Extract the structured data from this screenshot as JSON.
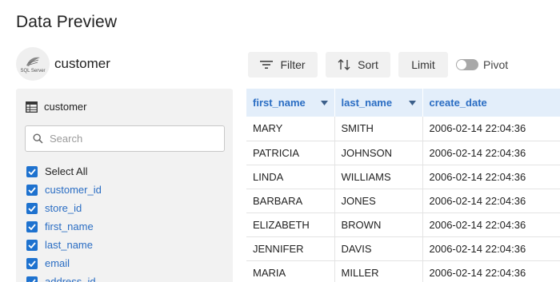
{
  "page": {
    "title": "Data Preview"
  },
  "source": {
    "name": "customer",
    "logo_text_1": "SQL Server"
  },
  "toolbar": {
    "filter_label": "Filter",
    "sort_label": "Sort",
    "limit_label": "Limit",
    "pivot_label": "Pivot",
    "pivot_on": false
  },
  "sidebar": {
    "table_name": "customer",
    "search_placeholder": "Search",
    "search_value": "",
    "select_all_label": "Select All",
    "columns": [
      "customer_id",
      "store_id",
      "first_name",
      "last_name",
      "email",
      "address_id"
    ]
  },
  "grid": {
    "columns": [
      "first_name",
      "last_name",
      "create_date"
    ],
    "rows": [
      [
        "MARY",
        "SMITH",
        "2006-02-14 22:04:36"
      ],
      [
        "PATRICIA",
        "JOHNSON",
        "2006-02-14 22:04:36"
      ],
      [
        "LINDA",
        "WILLIAMS",
        "2006-02-14 22:04:36"
      ],
      [
        "BARBARA",
        "JONES",
        "2006-02-14 22:04:36"
      ],
      [
        "ELIZABETH",
        "BROWN",
        "2006-02-14 22:04:36"
      ],
      [
        "JENNIFER",
        "DAVIS",
        "2006-02-14 22:04:36"
      ],
      [
        "MARIA",
        "MILLER",
        "2006-02-14 22:04:36"
      ]
    ]
  },
  "colors": {
    "accent": "#1e72cf",
    "header_bg": "#e3eefa",
    "header_text": "#2a6dc3",
    "panel_bg": "#f2f2f2",
    "button_bg": "#f1f1f1"
  },
  "icons": {
    "filter": "filter-lines-icon",
    "sort": "sort-arrows-icon",
    "table": "table-icon",
    "search": "magnifier-icon",
    "check": "check-icon",
    "dropdown": "caret-down-icon"
  }
}
